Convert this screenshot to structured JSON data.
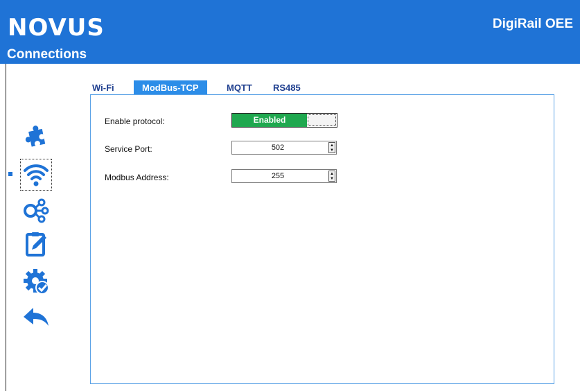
{
  "header": {
    "logo": "NOVUS",
    "section_title": "Connections",
    "product_name": "DigiRail OEE",
    "color": "#1f73d6"
  },
  "sidebar": {
    "icons": [
      "puzzle-icon",
      "wifi-icon",
      "share-nodes-icon",
      "clipboard-edit-icon",
      "gear-check-icon",
      "back-arrow-icon"
    ],
    "selected": "wifi-icon",
    "icon_color": "#1f73d6"
  },
  "tabs": [
    {
      "label": "Wi-Fi"
    },
    {
      "label": "ModBus-TCP",
      "active": true
    },
    {
      "label": "MQTT"
    },
    {
      "label": "RS485"
    }
  ],
  "form": {
    "enable_label": "Enable protocol:",
    "enable_value": "Enabled",
    "enable_color": "#1fa84f",
    "port_label": "Service Port:",
    "port_value": "502",
    "address_label": "Modbus Address:",
    "address_value": "255"
  }
}
